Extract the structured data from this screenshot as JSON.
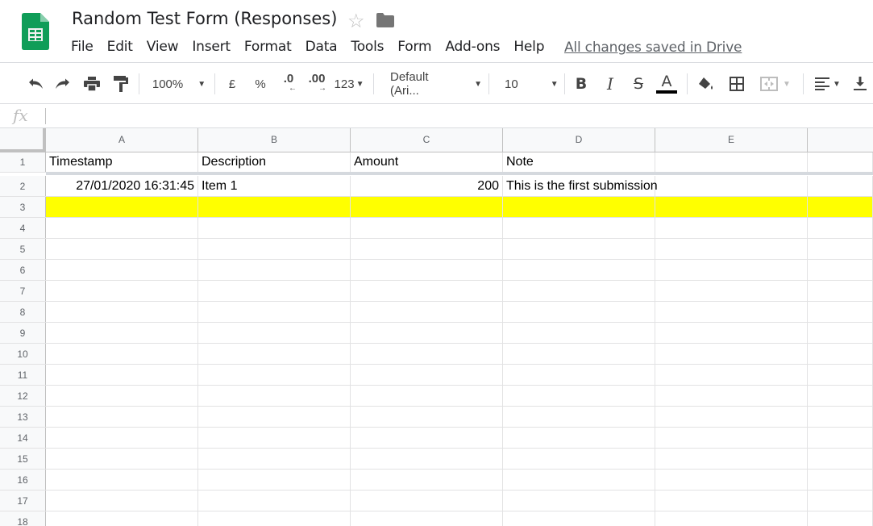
{
  "app": {
    "title": "Random Test Form (Responses)",
    "save_status": "All changes saved in Drive",
    "star_icon": "star-outline-icon",
    "folder_icon": "folder-icon",
    "logo_icon": "sheets-logo-icon",
    "brand_color": "#0f9d58"
  },
  "menu": [
    "File",
    "Edit",
    "View",
    "Insert",
    "Format",
    "Data",
    "Tools",
    "Form",
    "Add-ons",
    "Help"
  ],
  "toolbar": {
    "zoom": "100%",
    "currency": "£",
    "percent": "%",
    "decrease_decimals": ".0",
    "increase_decimals": ".00",
    "more_formats": "123",
    "font": "Default (Ari...",
    "font_size": "10",
    "bold": "B",
    "italic": "I",
    "strikethrough": "S",
    "text_color": "A",
    "text_color_value": "#000000"
  },
  "formula_bar": {
    "label": "fx",
    "value": ""
  },
  "sheet": {
    "columns": [
      "A",
      "B",
      "C",
      "D",
      "E"
    ],
    "rows": [
      {
        "num": "1",
        "cells": [
          "Timestamp",
          "Description",
          "Amount",
          "Note",
          ""
        ]
      },
      {
        "num": "2",
        "cells": [
          "27/01/2020 16:31:45",
          "Item 1",
          "200",
          "This is the first submission",
          ""
        ]
      },
      {
        "num": "3",
        "cells": [
          "",
          "",
          "",
          "",
          ""
        ],
        "highlight": "#ffff00"
      },
      {
        "num": "4",
        "cells": [
          "",
          "",
          "",
          "",
          ""
        ]
      },
      {
        "num": "5",
        "cells": [
          "",
          "",
          "",
          "",
          ""
        ]
      },
      {
        "num": "6",
        "cells": [
          "",
          "",
          "",
          "",
          ""
        ]
      },
      {
        "num": "7",
        "cells": [
          "",
          "",
          "",
          "",
          ""
        ]
      },
      {
        "num": "8",
        "cells": [
          "",
          "",
          "",
          "",
          ""
        ]
      },
      {
        "num": "9",
        "cells": [
          "",
          "",
          "",
          "",
          ""
        ]
      },
      {
        "num": "10",
        "cells": [
          "",
          "",
          "",
          "",
          ""
        ]
      },
      {
        "num": "11",
        "cells": [
          "",
          "",
          "",
          "",
          ""
        ]
      },
      {
        "num": "12",
        "cells": [
          "",
          "",
          "",
          "",
          ""
        ]
      },
      {
        "num": "13",
        "cells": [
          "",
          "",
          "",
          "",
          ""
        ]
      },
      {
        "num": "14",
        "cells": [
          "",
          "",
          "",
          "",
          ""
        ]
      },
      {
        "num": "15",
        "cells": [
          "",
          "",
          "",
          "",
          ""
        ]
      },
      {
        "num": "16",
        "cells": [
          "",
          "",
          "",
          "",
          ""
        ]
      },
      {
        "num": "17",
        "cells": [
          "",
          "",
          "",
          "",
          ""
        ]
      },
      {
        "num": "18",
        "cells": [
          "",
          "",
          "",
          "",
          ""
        ]
      }
    ]
  }
}
